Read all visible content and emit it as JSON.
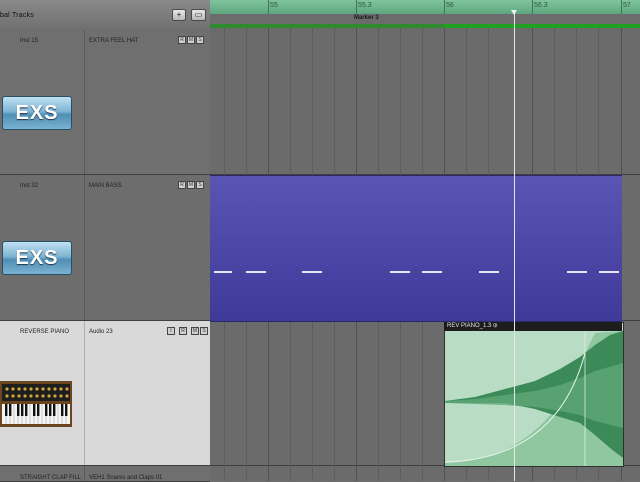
{
  "header": {
    "title": "bal Tracks",
    "add_label": "+",
    "folder_label": "▭"
  },
  "ruler": {
    "bars": [
      "55",
      "55.3",
      "56",
      "56.3",
      "57"
    ]
  },
  "marker": {
    "label": "Marker 3"
  },
  "tracks": [
    {
      "name": "Inst 15",
      "instrument": "EXTRA FEEL HAT",
      "plugin": "EXS",
      "buttons": [
        "R",
        "M",
        "S"
      ]
    },
    {
      "name": "Inst 32",
      "instrument": "MAIN BASS",
      "plugin": "EXS",
      "buttons": [
        "R",
        "M",
        "S"
      ]
    },
    {
      "name": "REVERSE PIANO",
      "instrument": "Audio 23",
      "plugin": "synth-keyboard",
      "buttons": [
        "I",
        "R",
        "M",
        "S"
      ]
    },
    {
      "name": "STRAIGHT CLAP FILL",
      "instrument": "VEH1 Snares and Claps 01"
    }
  ],
  "regions": {
    "audio": {
      "title": "REV PIANO_1.3 ⦶"
    }
  },
  "colors": {
    "ruler": "#6fb88d",
    "midi_region": "#4a45a8",
    "audio_region": "#b9dcc4",
    "waveform": "#2f7a4c",
    "marker_band": "#2e8b2e"
  }
}
